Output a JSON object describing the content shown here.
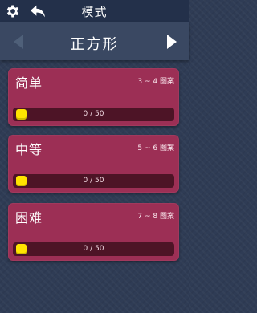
{
  "header": {
    "title": "模式",
    "icons": [
      "gear-icon",
      "back-arrow-icon"
    ]
  },
  "mode_selector": {
    "current": "正方形",
    "prev_icon": "triangle-left-icon",
    "next_icon": "triangle-right-icon"
  },
  "levels": [
    {
      "name": "简单",
      "range": "3 ~ 4 图案",
      "progress_text": "0 / 50",
      "progress": 0
    },
    {
      "name": "中等",
      "range": "5 ~ 6 图案",
      "progress_text": "0 / 50",
      "progress": 0
    },
    {
      "name": "困难",
      "range": "7 ~ 8 图案",
      "progress_text": "0 / 50",
      "progress": 0
    }
  ],
  "colors": {
    "background": "#2f3c55",
    "card": "#9c2f55",
    "progress_track": "#4d1426",
    "progress_knob": "#ffe400"
  }
}
